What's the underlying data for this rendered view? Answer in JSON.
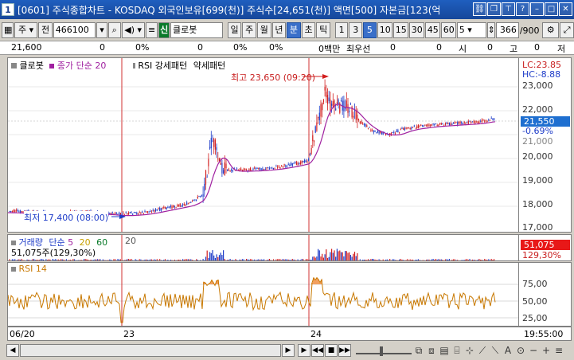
{
  "window": {
    "title": "[0601] 주식종합차트 - KOSDAQ 외국인보유[699(천)] 주식수[24,651(천)] 액면[500] 자본금[123(억",
    "icon_label": "1"
  },
  "toolbar": {
    "market_label": "주",
    "type_label": "전",
    "code_value": "466100",
    "signal_label": "신",
    "stock_name": "클로봇",
    "period_buttons": [
      "일",
      "주",
      "월",
      "년",
      "분",
      "초",
      "틱"
    ],
    "selected_period": "분",
    "interval_buttons": [
      "1",
      "3",
      "5",
      "10",
      "15",
      "30",
      "45",
      "60"
    ],
    "selected_interval": "5",
    "interval_value": "5",
    "count_value": "366",
    "count_total": "/900"
  },
  "infobar": {
    "values": [
      "21,600",
      "0",
      "0%",
      "0",
      "0%",
      "0%",
      "0백만",
      "최우선",
      "0",
      "0",
      "시",
      "0",
      "고",
      "0",
      "저"
    ]
  },
  "price_panel": {
    "legend_stock": "클로봇",
    "legend_ma": "종가 단순 20",
    "legend_pattern_1": "RSI 강세패턴",
    "legend_pattern_2": "약세패턴",
    "high_annotation": "최고 23,650 (09:20)",
    "low_annotation": "최저 17,400 (08:00)",
    "lc_label": "LC:23.85",
    "hc_label": "HC:-8.88",
    "axis_ticks": [
      "23,000",
      "22,000",
      "21,000",
      "20,000",
      "19,000",
      "18,000",
      "17,000"
    ],
    "current_price": "21,550",
    "current_change": "-0.69%"
  },
  "volume_panel": {
    "legend_title": "거래량",
    "legend_ma": "단순",
    "ma_periods": [
      "5",
      "20",
      "60"
    ],
    "ma_extra": "20",
    "volume_text": "51,075주(129,30%)",
    "axis_value": "51,075",
    "axis_percent": "129,30%"
  },
  "rsi_panel": {
    "legend": "RSI 14",
    "axis_ticks": [
      "75,00",
      "50,00",
      "25,00"
    ]
  },
  "time_axis": {
    "labels": [
      "06/20",
      "23",
      "24"
    ],
    "time": "19:55:00"
  },
  "colors": {
    "title_bar": "#1f5fbf",
    "candle_up": "#d21e1e",
    "candle_down": "#1e3cc8",
    "ma_line": "#a020a0",
    "rsi_line": "#c87800",
    "rsi_fill": "#f2a060",
    "axis_price_bg": "#1f6fd0",
    "volume_axis_bg": "#e81818"
  }
}
